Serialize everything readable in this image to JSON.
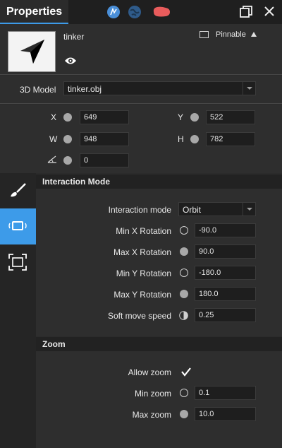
{
  "titlebar": {
    "title": "Properties",
    "icons": [
      "compass-icon",
      "globe-icon",
      "cloud-shape-icon",
      "maximize-icon",
      "close-icon"
    ]
  },
  "header": {
    "object_name": "tinker",
    "visibility_icon": "eye-icon",
    "pin_label": "Pinnable"
  },
  "model": {
    "label": "3D Model",
    "value": "tinker.obj"
  },
  "transform": {
    "x_label": "X",
    "x_value": "649",
    "y_label": "Y",
    "y_value": "522",
    "w_label": "W",
    "w_value": "948",
    "h_label": "H",
    "h_value": "782",
    "angle_value": "0"
  },
  "sidebar": {
    "items": [
      "brush-icon",
      "interaction-icon",
      "frame-icon"
    ],
    "active": "interaction-icon"
  },
  "interaction": {
    "section_title": "Interaction Mode",
    "mode_label": "Interaction mode",
    "mode_value": "Orbit",
    "min_x_label": "Min X Rotation",
    "min_x_value": "-90.0",
    "max_x_label": "Max X Rotation",
    "max_x_value": "90.0",
    "min_y_label": "Min Y Rotation",
    "min_y_value": "-180.0",
    "max_y_label": "Max Y Rotation",
    "max_y_value": "180.0",
    "soft_label": "Soft move speed",
    "soft_value": "0.25"
  },
  "zoom": {
    "section_title": "Zoom",
    "allow_label": "Allow zoom",
    "allow_checked": true,
    "min_label": "Min zoom",
    "min_value": "0.1",
    "max_label": "Max zoom",
    "max_value": "10.0"
  },
  "colors": {
    "accent": "#3d9be9",
    "blob": "#e95c5c",
    "background": "#2e2e2e"
  }
}
